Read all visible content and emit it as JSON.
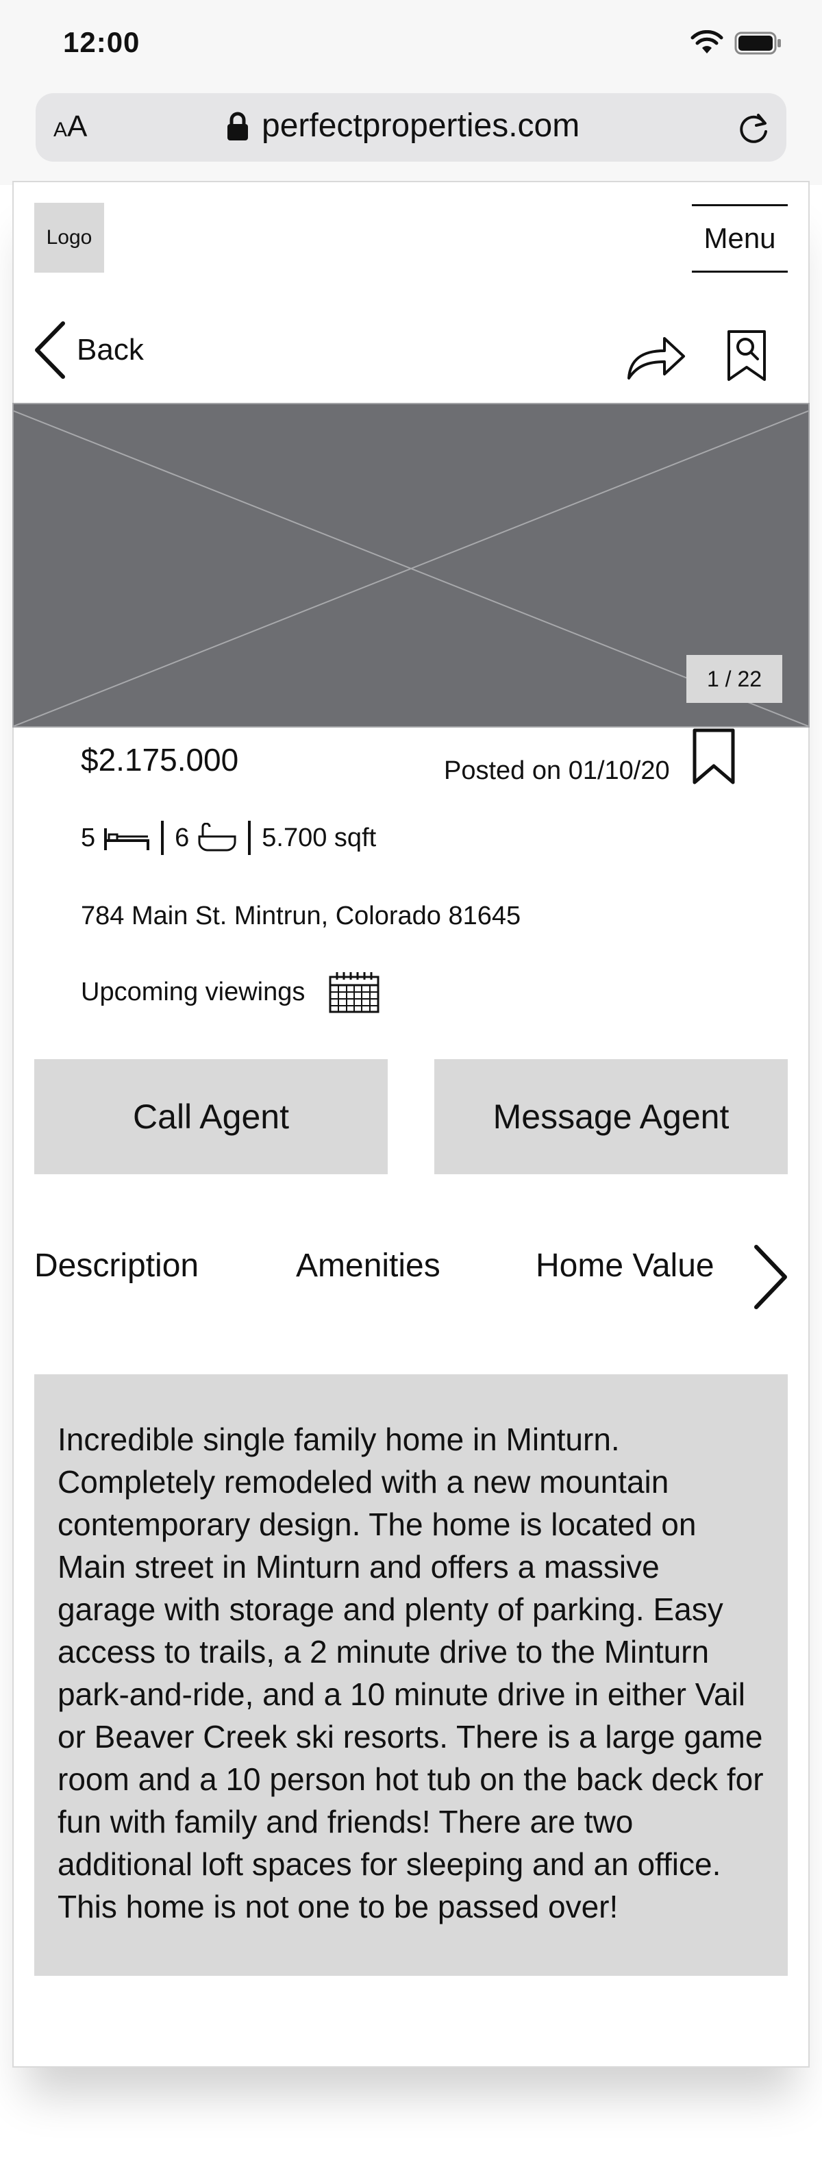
{
  "status_bar": {
    "time": "12:00"
  },
  "browser": {
    "text_size_small": "A",
    "text_size_large": "A",
    "url": "perfectproperties.com"
  },
  "header": {
    "logo": "Logo",
    "menu": "Menu"
  },
  "nav": {
    "back_label": "Back"
  },
  "gallery": {
    "counter": "1 / 22"
  },
  "listing": {
    "price": "$2.175.000",
    "posted": "Posted on 01/10/20",
    "beds": "5",
    "baths": "6",
    "area": "5.700 sqft",
    "address": "784 Main St.  Mintrun, Colorado 81645",
    "viewings_label": "Upcoming viewings"
  },
  "actions": {
    "call": "Call Agent",
    "message": "Message Agent"
  },
  "tabs": [
    {
      "label": "Description"
    },
    {
      "label": "Amenities"
    },
    {
      "label": "Home Value"
    }
  ],
  "description": "Incredible single family home in Minturn. Completely remodeled with a new mountain contemporary design.  The home is located on Main street in Minturn and offers a massive garage with storage and plenty of parking.  Easy access to trails, a 2 minute drive to the Minturn park-and-ride, and a 10 minute drive in either Vail or Beaver Creek ski resorts.  There is a large game room and a 10 person hot tub on the back deck for fun with family and friends!  There are two additional loft spaces for sleeping and an office.  This home is not one to be passed over!",
  "colors": {
    "placeholder_gray": "#d9d9d9",
    "hero_gray": "#6d6e72",
    "text": "#111111",
    "url_bar": "#e5e5e7"
  },
  "icons": [
    "wifi-icon",
    "battery-icon",
    "lock-icon",
    "reload-icon",
    "back-chevron-icon",
    "share-icon",
    "save-search-icon",
    "bookmark-icon",
    "bed-icon",
    "bathtub-icon",
    "calendar-icon",
    "chevron-right-icon"
  ]
}
